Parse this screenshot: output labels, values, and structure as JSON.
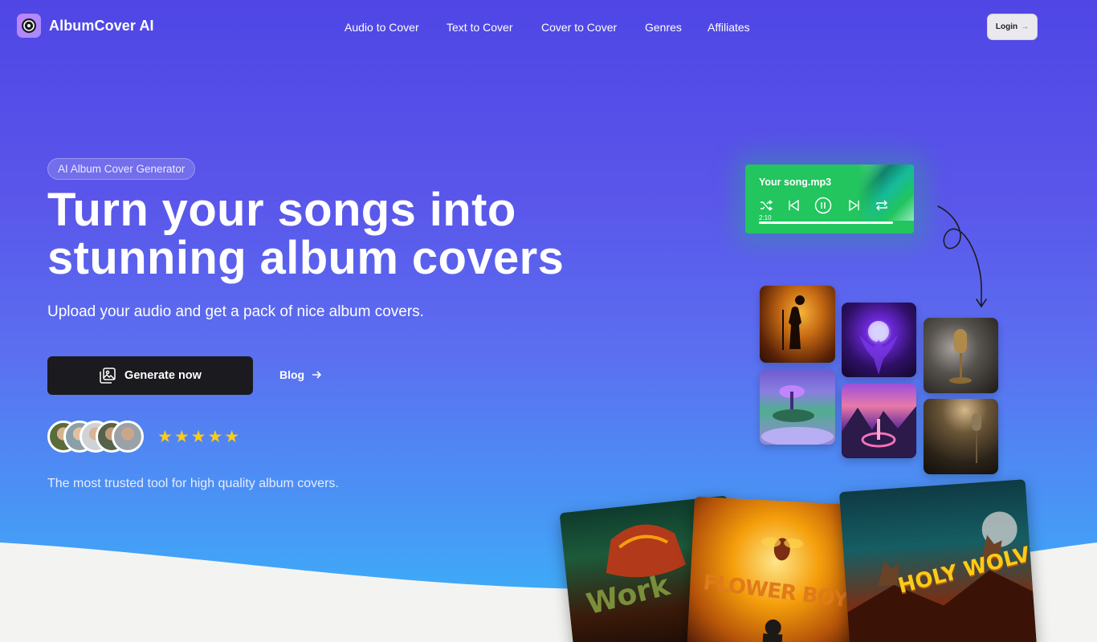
{
  "brand": {
    "name": "AlbumCover AI",
    "logo_icon": "vinyl-record-icon"
  },
  "nav": {
    "links": [
      "Audio to Cover",
      "Text to Cover",
      "Cover to Cover",
      "Genres",
      "Affiliates"
    ],
    "login_label": "Login",
    "login_icon": "arrow-right-icon"
  },
  "hero": {
    "badge": "AI Album Cover Generator",
    "headline_line1": "Turn your songs into",
    "headline_line2": "stunning album covers",
    "subheadline": "Upload your audio and get a pack of nice album covers.",
    "cta_label": "Generate now",
    "cta_icon": "images-icon",
    "blog_label": "Blog",
    "blog_icon": "arrow-right-icon",
    "rating_stars": 5,
    "stars_text": "★★★★★",
    "trusted_text": "The most trusted tool for high quality album covers."
  },
  "player": {
    "filename": "Your song.mp3",
    "time": "2:10",
    "progress": 1.0,
    "controls": [
      "shuffle-icon",
      "previous-icon",
      "pause-icon",
      "next-icon",
      "repeat-icon"
    ]
  },
  "showcase": {
    "covers": [
      {
        "name": "Work Hard",
        "text": "Work"
      },
      {
        "name": "Flower Boy",
        "text": "FLOWER BOY"
      },
      {
        "name": "Holy Wolves",
        "text": "HOLY WOLVES"
      }
    ]
  },
  "colors": {
    "gradient_top": "#4f46e5",
    "gradient_bottom": "#38b6f8",
    "cta_bg": "#1b1b1f",
    "player_green": "#22c55e",
    "star_yellow": "#facc15",
    "bottom_bg": "#f3f4f1"
  }
}
